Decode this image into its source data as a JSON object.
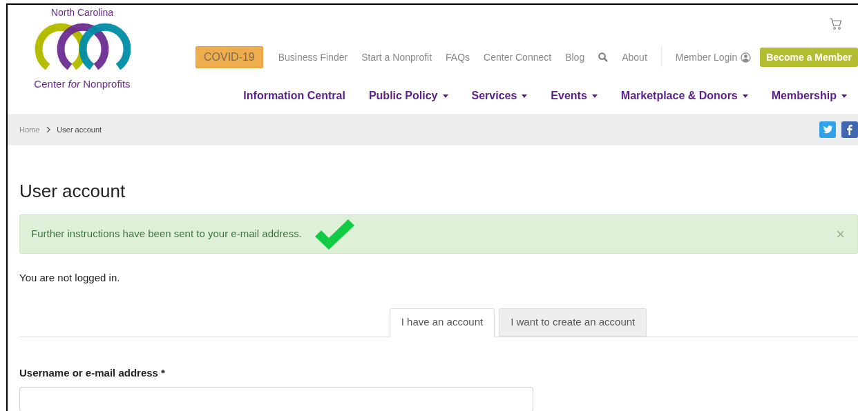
{
  "logo": {
    "top_text": "North Carolina",
    "bottom_text": "Center *for* Nonprofits"
  },
  "utility_nav": [
    {
      "kind": "highlight",
      "label": "COVID-19"
    },
    {
      "kind": "link",
      "label": "Business Finder"
    },
    {
      "kind": "link",
      "label": "Start a Nonprofit"
    },
    {
      "kind": "link",
      "label": "FAQs"
    },
    {
      "kind": "link",
      "label": "Center Connect"
    },
    {
      "kind": "link",
      "label": "Blog"
    },
    {
      "kind": "search"
    },
    {
      "kind": "link",
      "label": "About"
    },
    {
      "kind": "login",
      "label": "Member Login"
    },
    {
      "kind": "cta",
      "label": "Become a Member"
    }
  ],
  "main_nav": [
    {
      "label": "Information Central",
      "dropdown": false
    },
    {
      "label": "Public Policy",
      "dropdown": true
    },
    {
      "label": "Services",
      "dropdown": true
    },
    {
      "label": "Events",
      "dropdown": true
    },
    {
      "label": "Marketplace & Donors",
      "dropdown": true
    },
    {
      "label": "Membership",
      "dropdown": true
    }
  ],
  "breadcrumb": [
    "Home",
    "User account"
  ],
  "page_title": "User account",
  "alert": {
    "message": "Further instructions have been sent to your e-mail address.",
    "close": "×"
  },
  "status_text": "You are not logged in.",
  "tabs": [
    {
      "label": "I have an account",
      "selected": true
    },
    {
      "label": "I want to create an account",
      "selected": false
    }
  ],
  "form": {
    "field_label": "Username or e-mail address *"
  }
}
